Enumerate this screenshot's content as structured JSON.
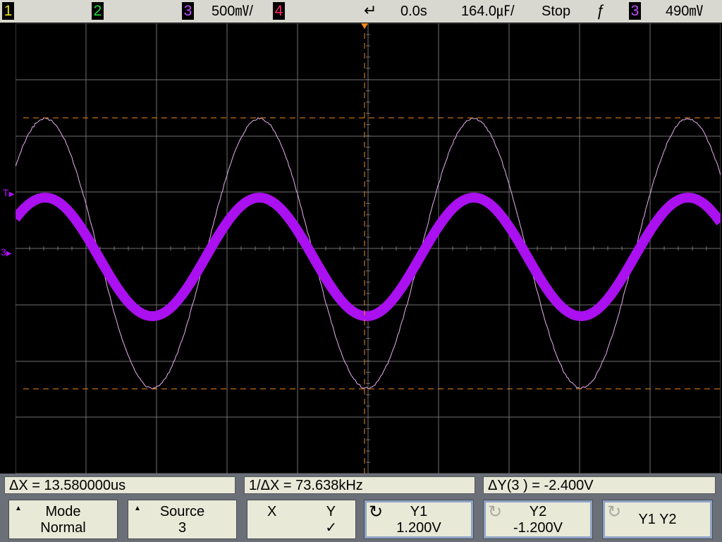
{
  "topbar": {
    "channels": [
      {
        "label": "1",
        "color": "#e8e020"
      },
      {
        "label": "2",
        "color": "#20e030"
      },
      {
        "label": "3",
        "color": "#c050ff"
      },
      {
        "label": "4",
        "color": "#ff3060"
      }
    ],
    "ch3_scale": "500㎷/",
    "time_offset": "0.0s",
    "time_scale": "164.0㎌/",
    "run_state": "Stop",
    "trigger_source": "3",
    "trigger_level": "490㎷"
  },
  "markers": {
    "trigger_level": "T",
    "channel_ground": "3"
  },
  "measurements": {
    "delta_x": "ΔX = 13.580000us",
    "inv_delta_x": "1/ΔX = 73.638kHz",
    "delta_y": "ΔY(3 ) = -2.400V"
  },
  "softkeys": [
    {
      "line1": "Mode",
      "line2": "Normal"
    },
    {
      "line1": "Source",
      "line2": "3"
    },
    {
      "line1_left": "X",
      "line1_right": "Y",
      "line2": "✓"
    },
    {
      "line1": "Y1",
      "line2": "1.200V"
    },
    {
      "line1": "Y2",
      "line2": "-1.200V"
    },
    {
      "line1": "Y1  Y2"
    }
  ],
  "colors": {
    "ch3_trace": "#aa10f0",
    "cursor": "#f08a1a",
    "grid": "#707070",
    "ref_trace": "#e8b0f0"
  }
}
